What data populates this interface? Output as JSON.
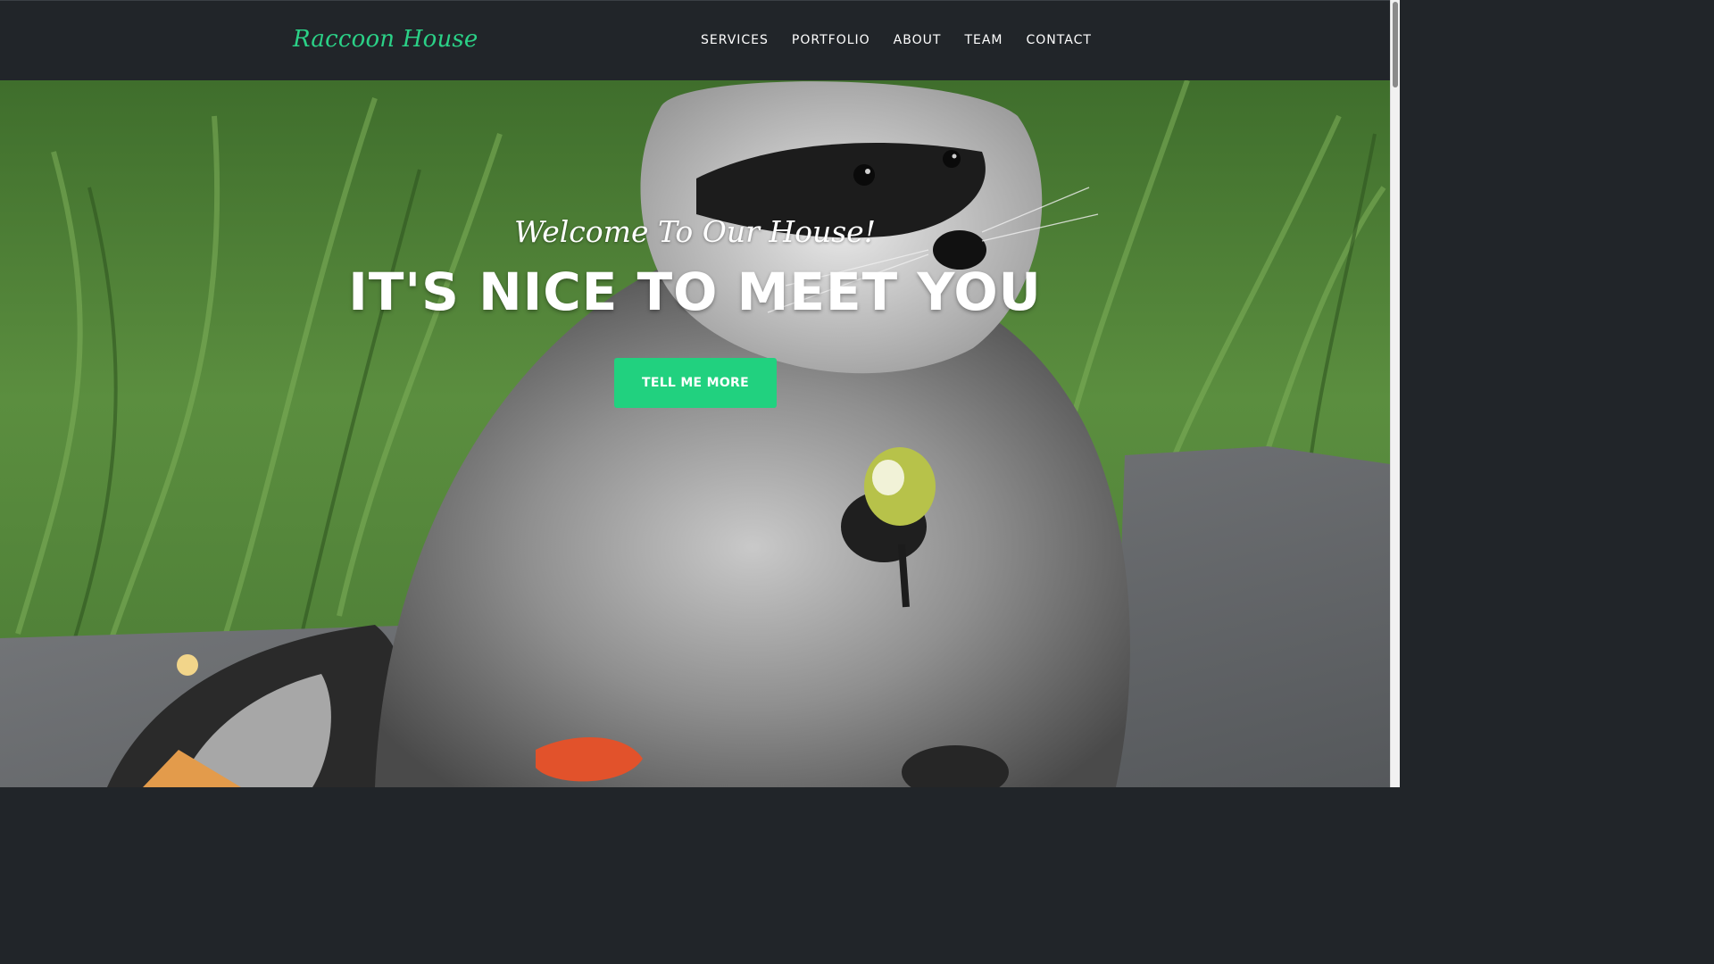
{
  "navbar": {
    "brand": "Raccoon House",
    "links": [
      {
        "label": "SERVICES"
      },
      {
        "label": "PORTFOLIO"
      },
      {
        "label": "ABOUT"
      },
      {
        "label": "TEAM"
      },
      {
        "label": "CONTACT"
      }
    ]
  },
  "hero": {
    "subheading": "Welcome To Our House!",
    "heading": "IT'S NICE TO MEET YOU",
    "cta_label": "TELL ME MORE",
    "background_image": "raccoon-eating-fruit-photo"
  },
  "colors": {
    "accent": "#21d17f",
    "navbar_bg": "#212529",
    "text_light": "#ffffff"
  }
}
